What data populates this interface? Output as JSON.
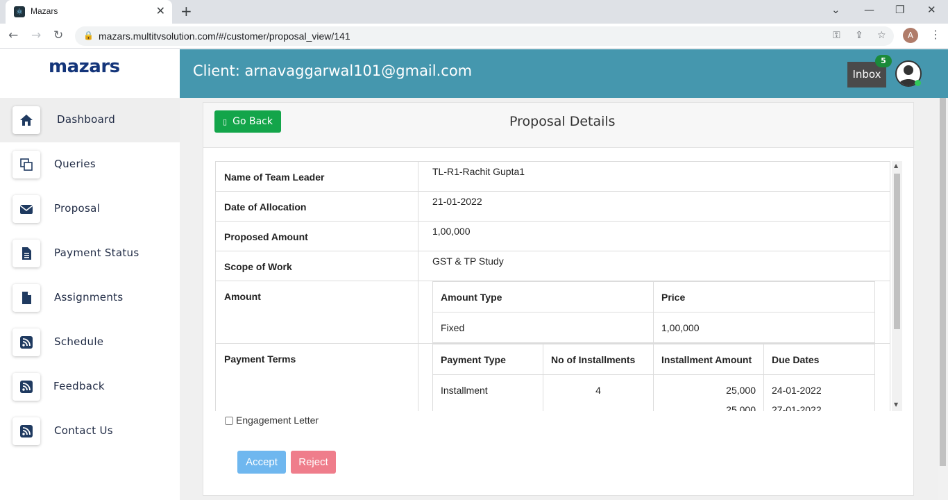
{
  "browser": {
    "tab_title": "Mazars",
    "url": "mazars.multitvsolution.com/#/customer/proposal_view/141",
    "profile_initial": "A"
  },
  "sidebar": {
    "logo": "mazars",
    "items": [
      {
        "label": "Dashboard",
        "icon": "home-icon"
      },
      {
        "label": "Queries",
        "icon": "copy-icon"
      },
      {
        "label": "Proposal",
        "icon": "envelope-icon"
      },
      {
        "label": "Payment Status",
        "icon": "document-icon"
      },
      {
        "label": "Assignments",
        "icon": "file-icon"
      },
      {
        "label": "Schedule",
        "icon": "rss-icon"
      },
      {
        "label": "Feedback",
        "icon": "rss-icon"
      },
      {
        "label": "Contact Us",
        "icon": "rss-icon"
      }
    ]
  },
  "header": {
    "client_title": "Client: arnavaggarwal101@gmail.com",
    "inbox_label": "Inbox",
    "inbox_count": "5"
  },
  "card": {
    "go_back_label": "Go Back",
    "title": "Proposal Details"
  },
  "details": {
    "rows": [
      {
        "label": "Name of Team Leader",
        "value": "TL-R1-Rachit Gupta1"
      },
      {
        "label": "Date of Allocation",
        "value": "21-01-2022"
      },
      {
        "label": "Proposed Amount",
        "value": "1,00,000"
      },
      {
        "label": "Scope of Work",
        "value": "GST & TP Study"
      }
    ],
    "amount_label": "Amount",
    "amount_table": {
      "headers": [
        "Amount Type",
        "Price"
      ],
      "row": [
        "Fixed",
        "1,00,000"
      ]
    },
    "payment_label": "Payment Terms",
    "payment_table": {
      "headers": [
        "Payment Type",
        "No of Installments",
        "Installment Amount",
        "Due Dates"
      ],
      "row": [
        "Installment",
        "4",
        "25,000",
        "24-01-2022"
      ],
      "partial_row": [
        "25,000",
        "27-01-2022"
      ]
    }
  },
  "engagement_label": "Engagement Letter",
  "accept_label": "Accept",
  "reject_label": "Reject"
}
